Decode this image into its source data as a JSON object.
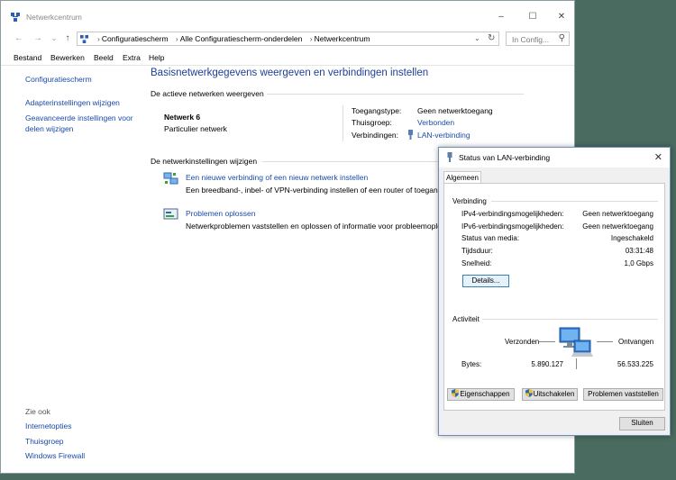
{
  "window": {
    "title": "Netwerkcentrum",
    "breadcrumbs": [
      "Configuratiescherm",
      "Alle Configuratiescherm-onderdelen",
      "Netwerkcentrum"
    ],
    "search_placeholder": "In Config..."
  },
  "menu": [
    "Bestand",
    "Bewerken",
    "Beeld",
    "Extra",
    "Help"
  ],
  "sidebar": {
    "home": "Configuratiescherm",
    "links": [
      "Adapterinstellingen wijzigen",
      "Geavanceerde instellingen voor delen wijzigen"
    ],
    "see_also_label": "Zie ook",
    "see_also": [
      "Internetopties",
      "Thuisgroep",
      "Windows Firewall"
    ]
  },
  "main": {
    "heading": "Basisnetwerkgegevens weergeven en verbindingen instellen",
    "active_networks_heading": "De actieve netwerken weergeven",
    "network": {
      "name": "Netwerk  6",
      "type": "Particulier netwerk",
      "access_label": "Toegangstype:",
      "access_value": "Geen netwerktoegang",
      "homegroup_label": "Thuisgroep:",
      "homegroup_value": "Verbonden",
      "connections_label": "Verbindingen:",
      "connections_value": "LAN-verbinding"
    },
    "change_settings_heading": "De netwerkinstellingen wijzigen",
    "tasks": [
      {
        "title": "Een nieuwe verbinding of een nieuw netwerk instellen",
        "desc": "Een breedband-, inbel- of VPN-verbinding instellen of een router of toegangspunt instellen."
      },
      {
        "title": "Problemen oplossen",
        "desc": "Netwerkproblemen vaststellen en oplossen of informatie voor probleemoplossing opvragen."
      }
    ]
  },
  "dialog": {
    "title": "Status van LAN-verbinding",
    "tab": "Algemeen",
    "connection_group": "Verbinding",
    "rows": [
      {
        "label": "IPv4-verbindingsmogelijkheden:",
        "value": "Geen netwerktoegang"
      },
      {
        "label": "IPv6-verbindingsmogelijkheden:",
        "value": "Geen netwerktoegang"
      },
      {
        "label": "Status van media:",
        "value": "Ingeschakeld"
      },
      {
        "label": "Tijdsduur:",
        "value": "03:31:48"
      },
      {
        "label": "Snelheid:",
        "value": "1,0 Gbps"
      }
    ],
    "details_button": "Details...",
    "activity_group": "Activiteit",
    "sent_label": "Verzonden",
    "received_label": "Ontvangen",
    "bytes_label": "Bytes:",
    "bytes_sent": "5.890.127",
    "bytes_received": "56.533.225",
    "buttons": [
      "Eigenschappen",
      "Uitschakelen",
      "Problemen vaststellen"
    ],
    "close_button": "Sluiten"
  },
  "colors": {
    "link": "#1a4aa8",
    "heading": "#1c3f95",
    "desktop": "#4a6b5f"
  }
}
